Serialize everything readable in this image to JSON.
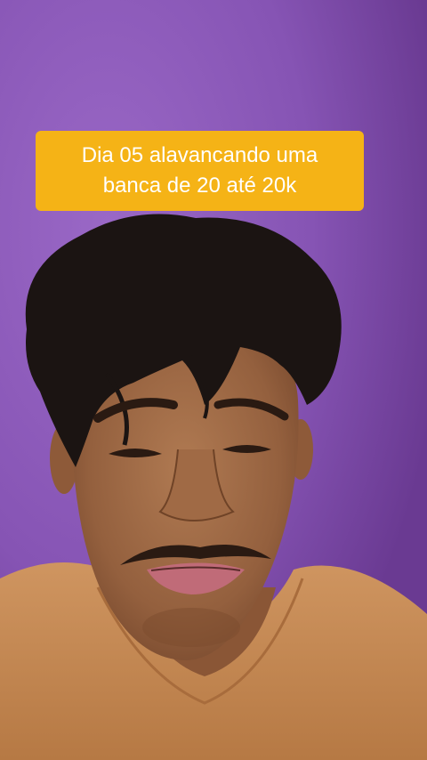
{
  "caption": {
    "line1": "Dia 05 alavancando uma",
    "line2": "banca de 20 até 20k",
    "background_color": "#f5b316",
    "text_color": "#ffffff"
  },
  "scene": {
    "wall_color": "#8654b4",
    "shirt_color": "#c58a55",
    "skin_color": "#9a6543",
    "hair_color": "#1b1412"
  }
}
